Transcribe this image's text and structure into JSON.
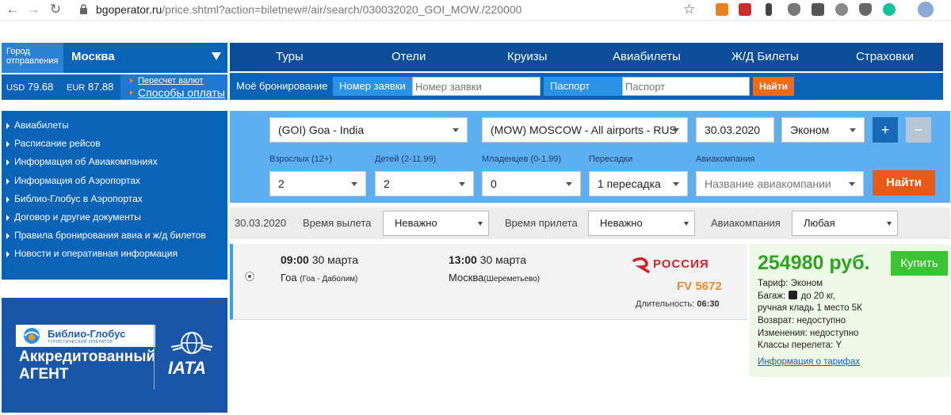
{
  "browser": {
    "url_host": "bgoperator.ru",
    "url_path": "/price.shtml?action=biletnew#/air/search/030032020_GOI_MOW./220000"
  },
  "city": {
    "label_line1": "Город",
    "label_line2": "отправления",
    "value": "Москва"
  },
  "currency": {
    "usd_code": "USD",
    "usd_value": "79.68",
    "eur_code": "EUR",
    "eur_value": "87.88",
    "recalc_link": "Пересчет валют",
    "payment_link": "Способы оплаты"
  },
  "topnav": [
    "Туры",
    "Отели",
    "Круизы",
    "Авиабилеты",
    "Ж/Д Билеты",
    "Страховки"
  ],
  "booking": {
    "my_booking": "Моё бронирование",
    "order_label": "Номер заявки",
    "order_placeholder": "Номер заявки",
    "passport_label": "Паспорт",
    "passport_placeholder": "Паспорт",
    "find": "Найти"
  },
  "sidemenu": [
    "Авиабилеты",
    "Расписание рейсов",
    "Информация об Авиакомпаниях",
    "Информация об Аэропортах",
    "Библио-Глобус в Аэропортах",
    "Договор и другие документы",
    "Правила бронирования авиа и ж/д билетов",
    "Новости и оперативная информация"
  ],
  "banner": {
    "brand": "Библио-Глобус",
    "brand_sub": "ТУРИСТИЧЕСКИЙ ОПЕРАТОР",
    "line1": "Аккредитованный",
    "line2": "АГЕНТ",
    "iata": "IATA"
  },
  "search": {
    "from": "(GOI) Goa - India",
    "to": "(MOW) MOSCOW - All airports - RUS",
    "date": "30.03.2020",
    "class": "Эконом",
    "plus": "+",
    "minus": "−",
    "adults_label": "Взрослых (12+)",
    "adults": "2",
    "children_label": "Детей (2-11.99)",
    "children": "2",
    "infants_label": "Младенцев (0-1.99)",
    "infants": "0",
    "transfers_label": "Пересадки",
    "transfers": "1 пересадка",
    "airline_label": "Авиакомпания",
    "airline_placeholder": "Название авиакомпании",
    "find": "Найти"
  },
  "filters": {
    "date": "30.03.2020",
    "depart_label": "Время вылета",
    "depart_value": "Неважно",
    "arrive_label": "Время прилета",
    "arrive_value": "Неважно",
    "airline_label": "Авиакомпания",
    "airline_value": "Любая"
  },
  "result": {
    "dep_time": "09:00",
    "dep_date": "30 марта",
    "dep_city": "Гоа",
    "dep_airport": "(Гоа - Даболим)",
    "arr_time": "13:00",
    "arr_date": "30 марта",
    "arr_city": "Москва",
    "arr_airport": "(Шереметьево)",
    "airline": "РОССИЯ",
    "flight": "FV 5672",
    "duration_label": "Длительность:",
    "duration": "06:30"
  },
  "price": {
    "amount": "254980 руб.",
    "buy": "Купить",
    "tariff": "Тариф: Эконом",
    "baggage_pre": "Багаж:",
    "baggage_post": "до 20 кг,",
    "hand": "ручная кладь 1 место 5К",
    "refund": "Возврат: недоступно",
    "changes": "Изменения: недоступно",
    "classes": "Классы перелета: Y",
    "tariff_link": "Информация о тарифах"
  },
  "colors": {
    "dark_blue": "#0b4d96",
    "blue": "#0b63b8",
    "light_blue": "#5eaef2",
    "orange": "#e85a16",
    "green": "#3bc432",
    "price_green": "#2ea51e",
    "airline_red": "#d3202a"
  }
}
